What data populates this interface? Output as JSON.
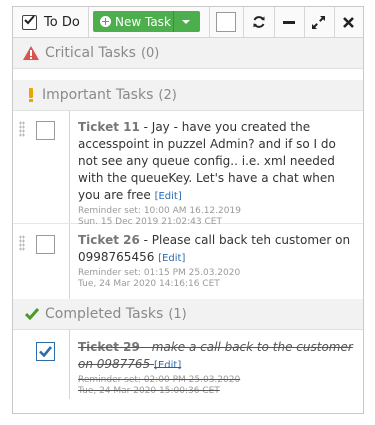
{
  "toolbar": {
    "title": "To Do",
    "new_task_label": "New Task",
    "icons": [
      "checkbox-icon",
      "plus-circle-icon",
      "caret-down-icon",
      "refresh-icon",
      "minus-icon",
      "expand-icon",
      "close-icon"
    ]
  },
  "sections": {
    "critical": {
      "title": "Critical Tasks",
      "count": "(0)",
      "icon": "warning-icon",
      "color": "#d9534f"
    },
    "important": {
      "title": "Important Tasks",
      "count": "(2)",
      "icon": "exclamation-icon",
      "color": "#e6a700"
    },
    "completed": {
      "title": "Completed Tasks",
      "count": "(1)",
      "icon": "checkmark-icon",
      "color": "#4a9a2a"
    }
  },
  "important_tasks": [
    {
      "name": "Ticket 11",
      "text": " - Jay - have you created the accesspoint in puzzel Admin? and if so I do not see any queue config.. i.e. xml needed with the queueKey. Let's have a chat when you are free",
      "edit_label": "Edit",
      "reminder": "Reminder set: 10:00 AM 16.12.2019",
      "created": "Sun, 15 Dec 2019 21:02:43 CET"
    },
    {
      "name": "Ticket 26",
      "text": " - Please call back teh customer on 0998765456",
      "edit_label": "Edit",
      "reminder": "Reminder set: 01:15 PM 25.03.2020",
      "created": "Tue, 24 Mar 2020 14:16:16 CET"
    }
  ],
  "completed_tasks": [
    {
      "name": "Ticket 29",
      "text": " - make a call back to the customer on 0987765",
      "edit_label": "Edit",
      "reminder": "Reminder set: 02:00 PM 25.03.2020",
      "created": "Tue, 24 Mar 2020 15:00:36 CET"
    }
  ],
  "colors": {
    "accent_green": "#4cae4c",
    "link_blue": "#2a6aad",
    "check_blue": "#2d6ea8"
  }
}
